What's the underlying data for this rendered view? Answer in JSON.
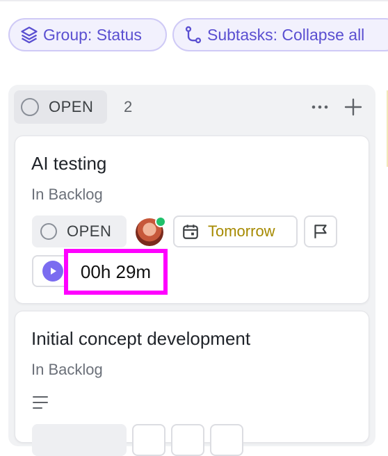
{
  "toolbar": {
    "group_label": "Group: Status",
    "subtasks_label": "Subtasks: Collapse all"
  },
  "column": {
    "status": "OPEN",
    "count": "2"
  },
  "cards": [
    {
      "title": "AI testing",
      "list": "In Backlog",
      "status": "OPEN",
      "due": "Tomorrow",
      "time_tracked": "00h 29m"
    },
    {
      "title": "Initial concept development",
      "list": "In Backlog"
    }
  ],
  "colors": {
    "accent": "#5a4fd1",
    "date_text": "#a68a00",
    "online": "#1fc16b",
    "highlight": "#ff00ff"
  },
  "icons": [
    "layers-icon",
    "subtasks-icon",
    "more-icon",
    "plus-icon",
    "calendar-icon",
    "flag-icon",
    "play-icon",
    "description-icon"
  ]
}
